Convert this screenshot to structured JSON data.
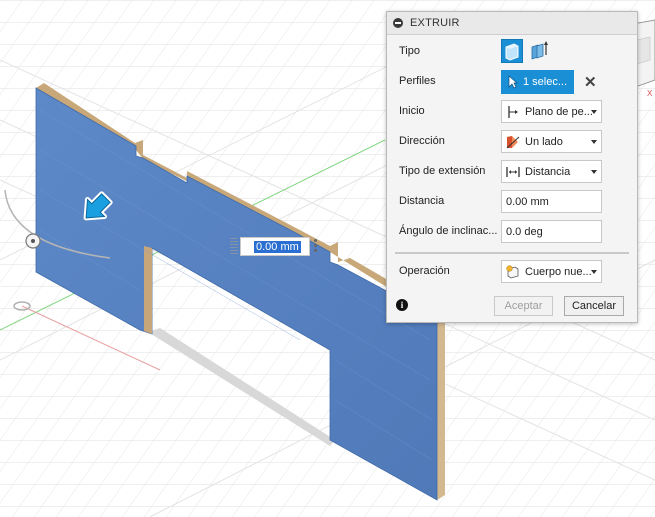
{
  "dialog": {
    "title": "EXTRUIR",
    "rows": {
      "tipo": {
        "label": "Tipo"
      },
      "perfiles": {
        "label": "Perfiles",
        "value": "1 selec..."
      },
      "inicio": {
        "label": "Inicio",
        "value": "Plano de pe..."
      },
      "direccion": {
        "label": "Dirección",
        "value": "Un lado"
      },
      "tipo_extension": {
        "label": "Tipo de extensión",
        "value": "Distancia"
      },
      "distancia": {
        "label": "Distancia",
        "value": "0.00 mm"
      },
      "angulo": {
        "label": "Ángulo de inclinac...",
        "value": "0.0 deg"
      },
      "operacion": {
        "label": "Operación",
        "value": "Cuerpo nue..."
      }
    },
    "buttons": {
      "ok": "Aceptar",
      "cancel": "Cancelar"
    },
    "info": "i"
  },
  "viewport": {
    "distance_field": "0.00 mm",
    "viewcube_axis": "X"
  },
  "colors": {
    "accent": "#1a8fd6",
    "panel": "#5b86c4",
    "panel_edge": "#c8a878"
  }
}
